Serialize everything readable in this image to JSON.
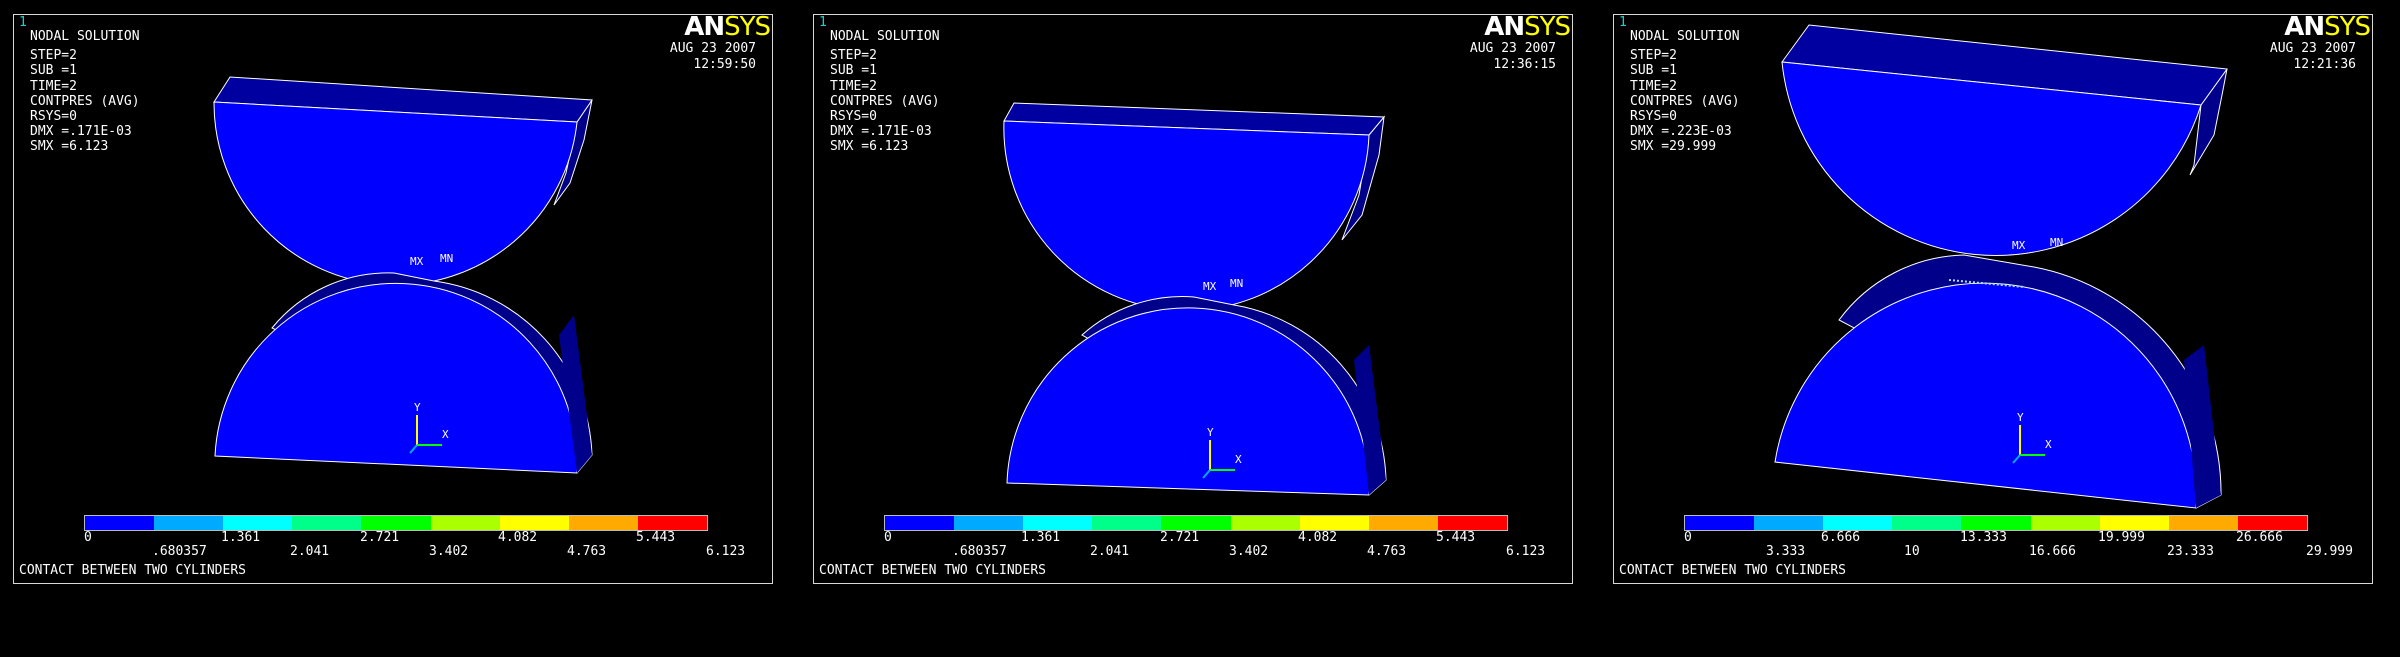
{
  "logo": {
    "an": "AN",
    "sys": "SYS"
  },
  "window_number": "1",
  "colorbar": [
    "#0000ff",
    "#00aaff",
    "#00ffff",
    "#00ff88",
    "#00ff00",
    "#aaff00",
    "#ffff00",
    "#ffaa00",
    "#ff0000"
  ],
  "panels": [
    {
      "title": "NODAL SOLUTION",
      "step": "STEP=2",
      "sub": "SUB =1",
      "time": "TIME=2",
      "quantity": "CONTPRES (AVG)",
      "rsys": "RSYS=0",
      "dmx": "DMX =.171E-03",
      "smx": "SMX =6.123",
      "date": "AUG 23 2007",
      "clock": "12:59:50",
      "mx_label": "MX",
      "mn_label": "MN",
      "axis_y": "Y",
      "axis_x": "X",
      "legend_top": [
        "0",
        "1.361",
        "2.721",
        "4.082",
        "5.443"
      ],
      "legend_bottom": [
        ".680357",
        "2.041",
        "3.402",
        "4.763",
        "6.123"
      ],
      "caption": "CONTACT BETWEEN TWO CYLINDERS"
    },
    {
      "title": "NODAL SOLUTION",
      "step": "STEP=2",
      "sub": "SUB =1",
      "time": "TIME=2",
      "quantity": "CONTPRES (AVG)",
      "rsys": "RSYS=0",
      "dmx": "DMX =.171E-03",
      "smx": "SMX =6.123",
      "date": "AUG 23 2007",
      "clock": "12:36:15",
      "mx_label": "MX",
      "mn_label": "MN",
      "axis_y": "Y",
      "axis_x": "X",
      "legend_top": [
        "0",
        "1.361",
        "2.721",
        "4.082",
        "5.443"
      ],
      "legend_bottom": [
        ".680357",
        "2.041",
        "3.402",
        "4.763",
        "6.123"
      ],
      "caption": "CONTACT BETWEEN TWO CYLINDERS"
    },
    {
      "title": "NODAL SOLUTION",
      "step": "STEP=2",
      "sub": "SUB =1",
      "time": "TIME=2",
      "quantity": "CONTPRES (AVG)",
      "rsys": "RSYS=0",
      "dmx": "DMX =.223E-03",
      "smx": "SMX =29.999",
      "date": "AUG 23 2007",
      "clock": "12:21:36",
      "mx_label": "MX",
      "mn_label": "MN",
      "axis_y": "Y",
      "axis_x": "X",
      "legend_top": [
        "0",
        "6.666",
        "13.333",
        "19.999",
        "26.666"
      ],
      "legend_bottom": [
        "3.333",
        "10",
        "16.666",
        "23.333",
        "29.999"
      ],
      "caption": "CONTACT BETWEEN TWO CYLINDERS"
    }
  ]
}
